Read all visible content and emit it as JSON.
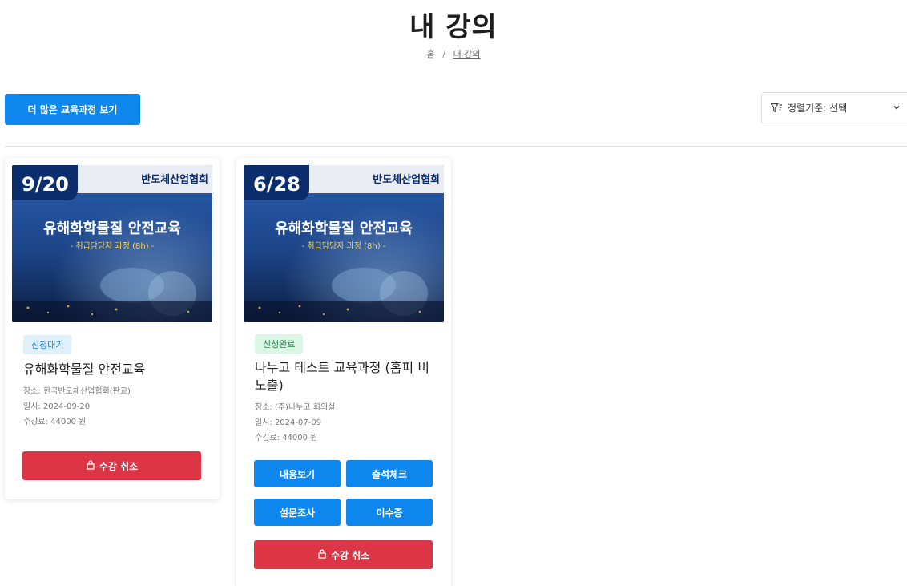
{
  "page": {
    "title": "내 강의"
  },
  "breadcrumb": {
    "home": "홈",
    "separator": "/",
    "current": "내 강의"
  },
  "toolbar": {
    "more_courses_label": "더 많은 교육과정 보기",
    "sort_label": "정렬기준:",
    "sort_value": "선택"
  },
  "cards": [
    {
      "banner": {
        "date": "9/20",
        "org": "반도체산업협회",
        "headline": "유해화학물질 안전교육",
        "subline": "- 취급담당자 과정 (8h) -"
      },
      "status": "신청대기",
      "title": "유해화학물질 안전교육",
      "place": "장소: 한국반도체산업협회(판교)",
      "date": "일시: 2024-09-20",
      "fee": "수강료: 44000 원",
      "cancel_label": "수강 취소"
    },
    {
      "banner": {
        "date": "6/28",
        "org": "반도체산업협회",
        "headline": "유해화학물질 안전교육",
        "subline": "- 취급담당자 과정 (8h) -"
      },
      "status": "신청완료",
      "title": "나누고 테스트 교육과정 (홈피 비노출)",
      "place": "장소: (주)나누고 회의실",
      "date": "일시: 2024-07-09",
      "fee": "수강료: 44000 원",
      "actions": {
        "view": "내용보기",
        "attendance": "출석체크",
        "survey": "설문조사",
        "certificate": "이수증"
      },
      "cancel_label": "수강 취소"
    }
  ],
  "colors": {
    "primary": "#0d86ee",
    "danger": "#dc3545",
    "banner_navy": "#0c2d6b"
  }
}
